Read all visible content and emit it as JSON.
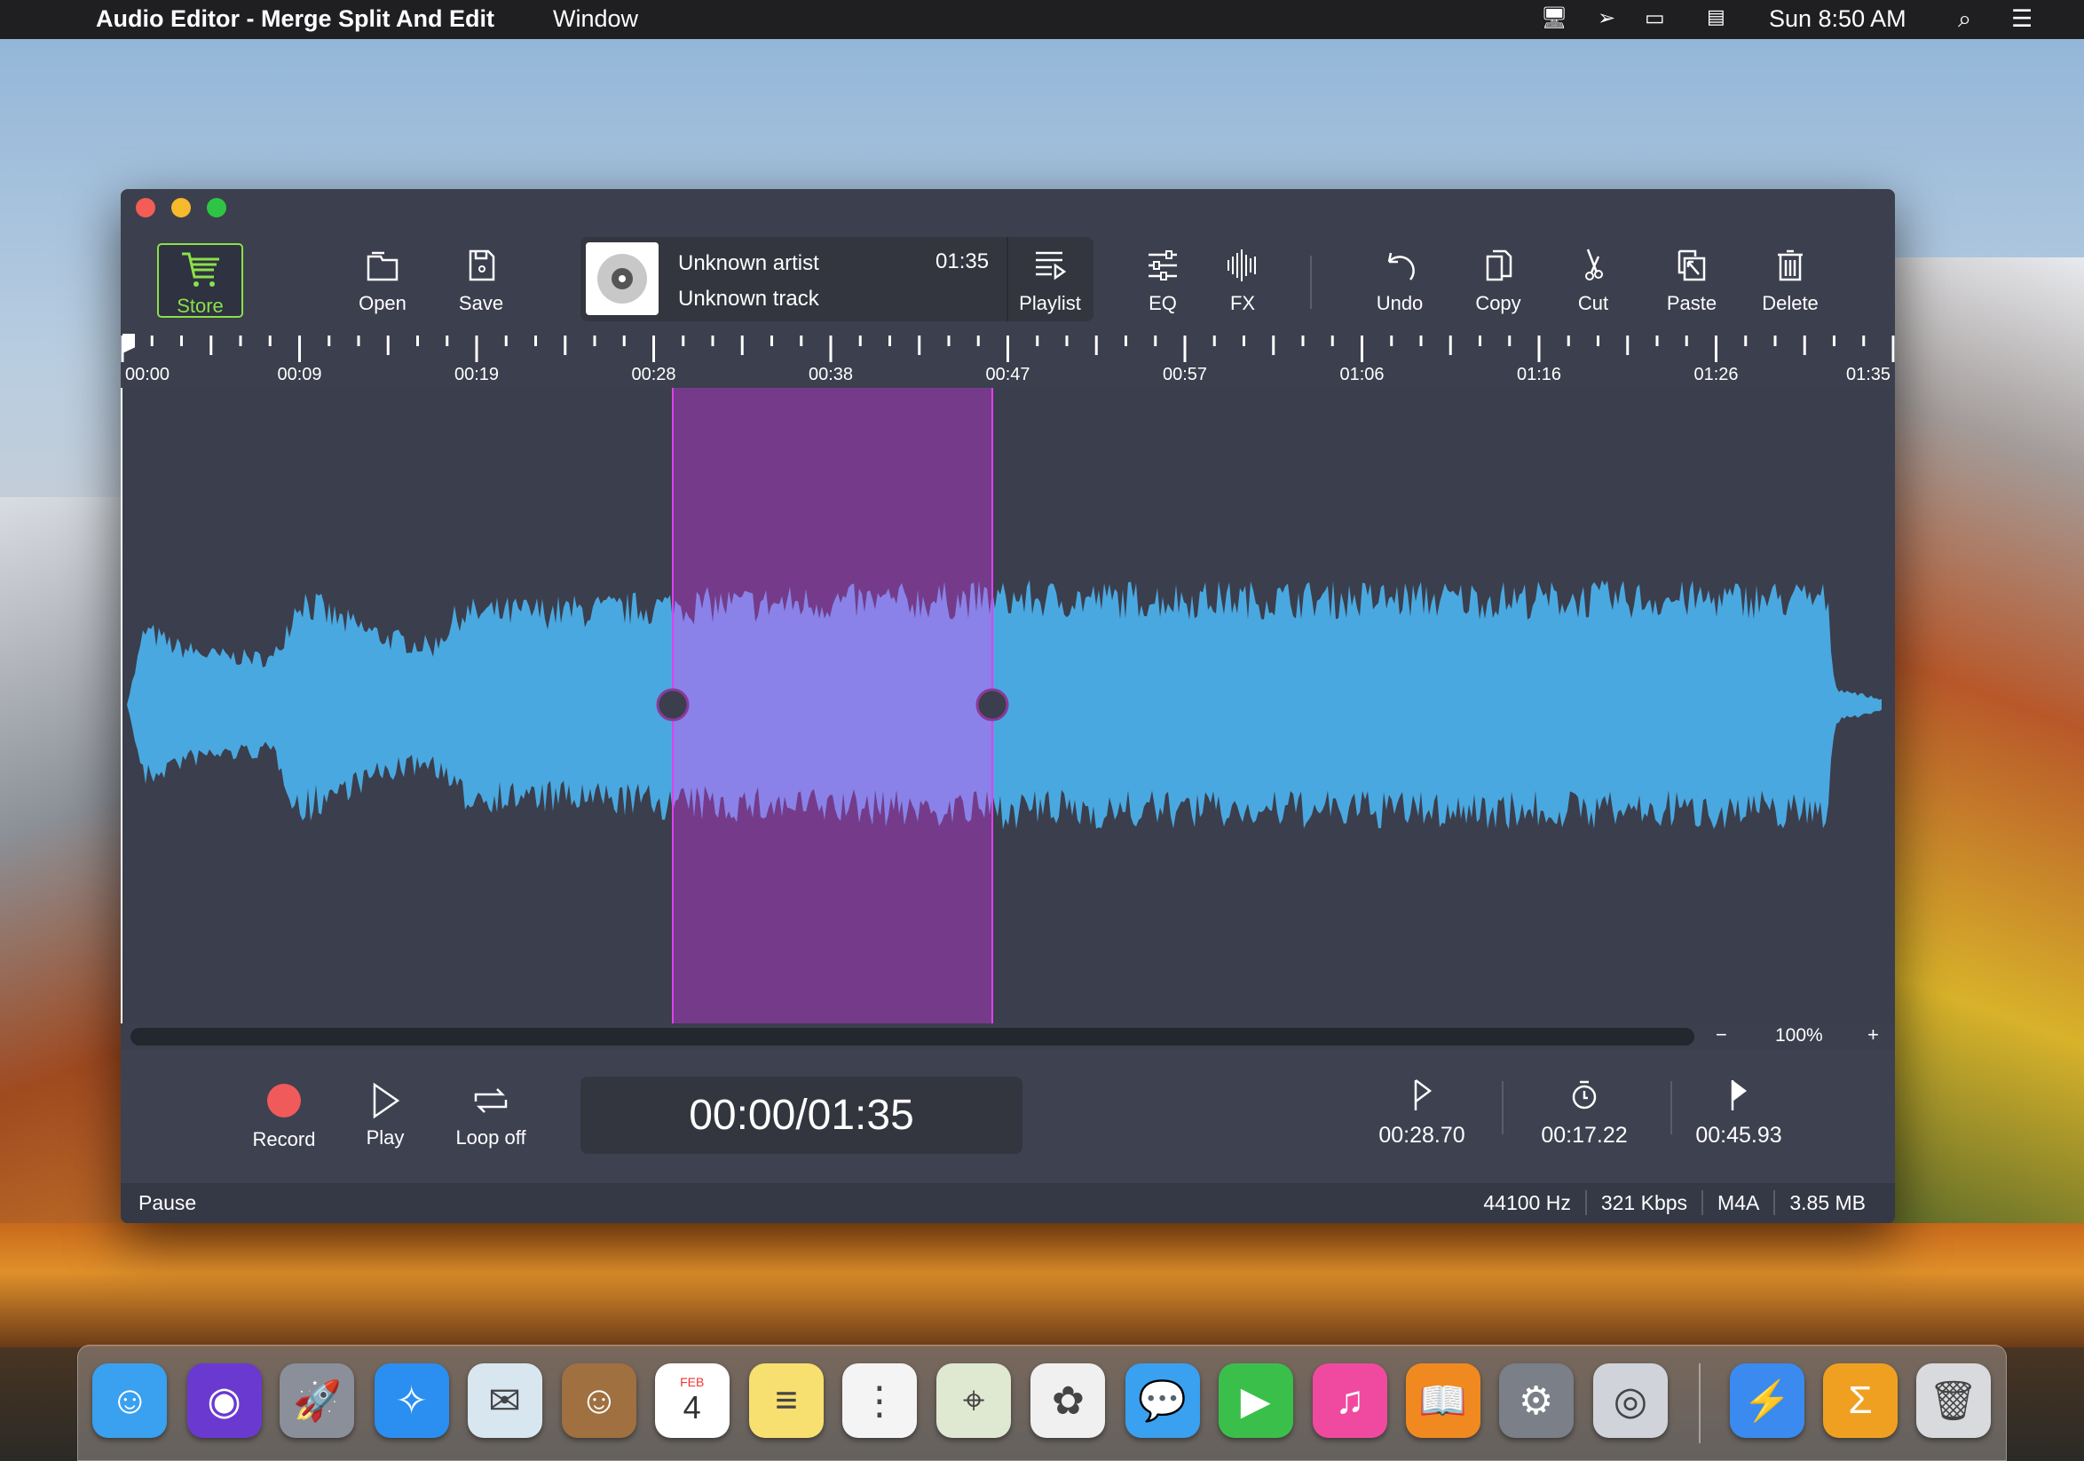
{
  "menubar": {
    "app_title": "Audio Editor - Merge Split And Edit",
    "menu_window": "Window",
    "clock": "Sun 8:50 AM"
  },
  "toolbar": {
    "store": "Store",
    "open": "Open",
    "save": "Save",
    "playlist": "Playlist",
    "eq": "EQ",
    "fx": "FX",
    "undo": "Undo",
    "copy": "Copy",
    "cut": "Cut",
    "paste": "Paste",
    "delete": "Delete"
  },
  "track": {
    "artist": "Unknown artist",
    "title": "Unknown track",
    "duration": "01:35"
  },
  "ruler": {
    "labels": [
      "00:00",
      "00:09",
      "00:19",
      "00:28",
      "00:38",
      "00:47",
      "00:57",
      "01:06",
      "01:16",
      "01:26",
      "01:35"
    ]
  },
  "selection": {
    "start": "00:28.70",
    "duration": "00:17.22",
    "end": "00:45.93"
  },
  "zoom": {
    "minus": "−",
    "level": "100%",
    "plus": "+"
  },
  "transport": {
    "record": "Record",
    "play": "Play",
    "loop": "Loop off",
    "time": "00:00/01:35"
  },
  "status": {
    "state": "Pause",
    "sample_rate": "44100 Hz",
    "bitrate": "321 Kbps",
    "format": "M4A",
    "size": "3.85 MB"
  },
  "colors": {
    "waveform": "#4aa8e0",
    "selection_bg": "#753b8a",
    "selection_wave": "#8a82e8",
    "store_accent": "#8be04a",
    "record": "#f05a5a"
  },
  "dock": [
    "finder",
    "siri",
    "launchpad",
    "safari",
    "mail",
    "contacts",
    "calendar",
    "notes",
    "reminders",
    "maps",
    "photos",
    "messages",
    "facetime",
    "itunes",
    "ibooks",
    "system-preferences",
    "audio-editor",
    "reeder",
    "sigma",
    "trash"
  ],
  "calendar": {
    "month": "FEB",
    "day": "4"
  }
}
